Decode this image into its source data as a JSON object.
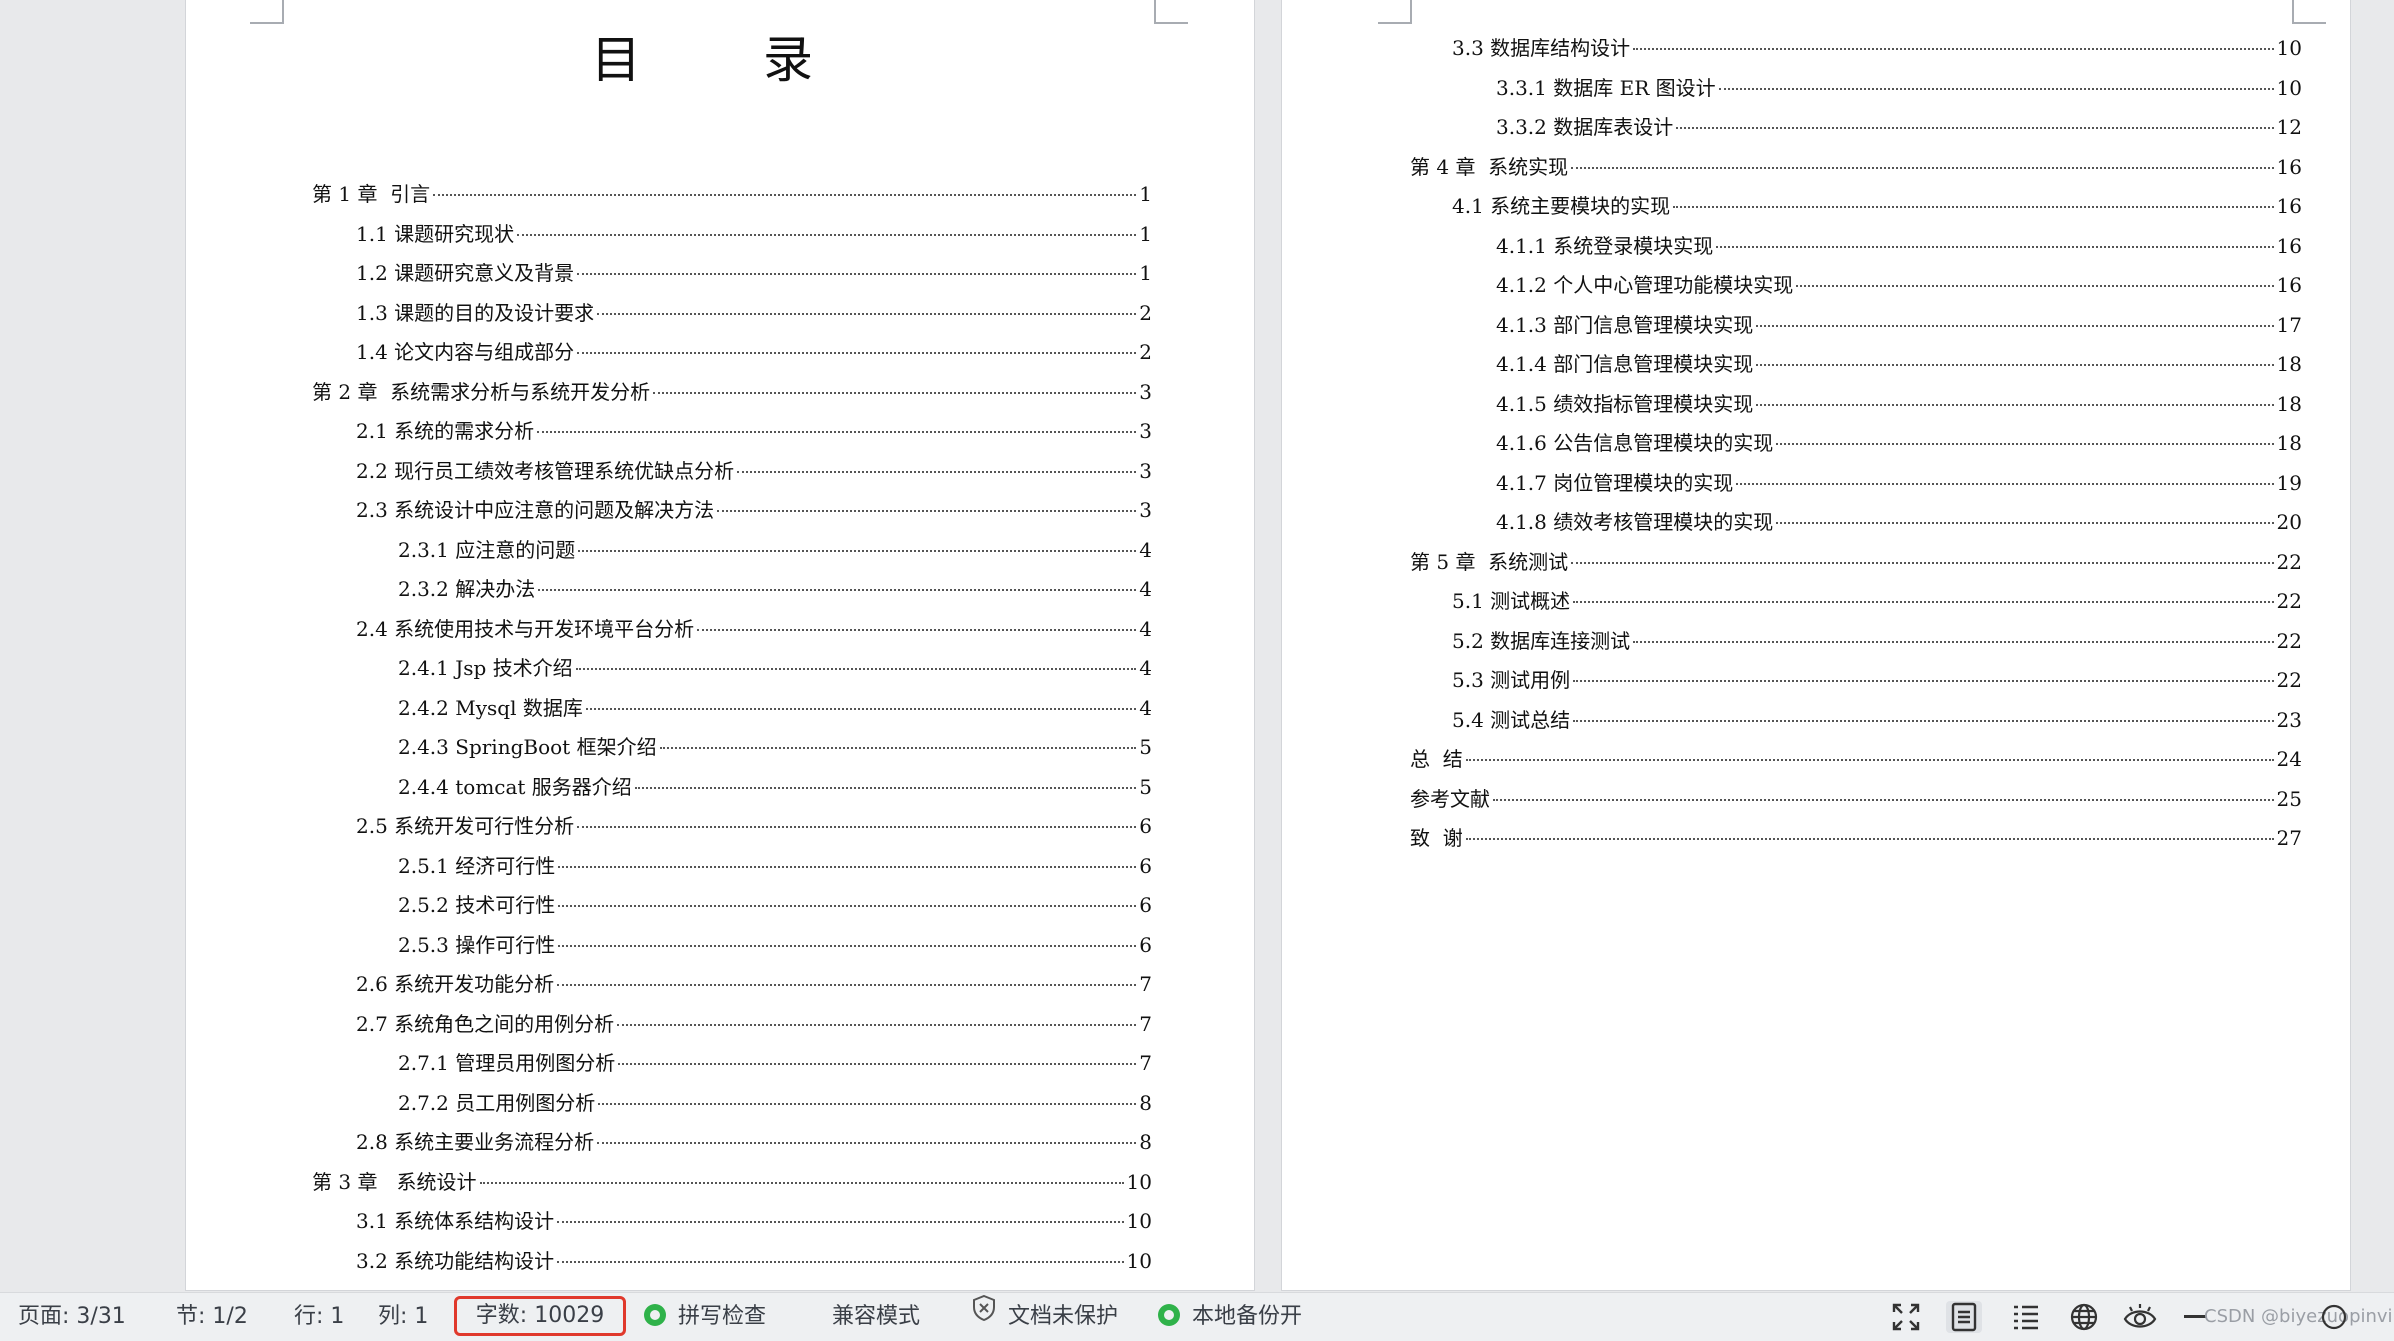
{
  "toc_title": "目　录",
  "left_entries": [
    {
      "label": "第 1 章  引言",
      "page": "1",
      "level": 0
    },
    {
      "label": "1.1 课题研究现状",
      "page": "1",
      "level": 1
    },
    {
      "label": "1.2 课题研究意义及背景",
      "page": "1",
      "level": 1
    },
    {
      "label": "1.3 课题的目的及设计要求",
      "page": "2",
      "level": 1
    },
    {
      "label": "1.4 论文内容与组成部分",
      "page": "2",
      "level": 1
    },
    {
      "label": "第 2 章  系统需求分析与系统开发分析",
      "page": "3",
      "level": 0
    },
    {
      "label": "2.1 系统的需求分析",
      "page": "3",
      "level": 1
    },
    {
      "label": "2.2 现行员工绩效考核管理系统优缺点分析",
      "page": "3",
      "level": 1
    },
    {
      "label": "2.3 系统设计中应注意的问题及解决方法",
      "page": "3",
      "level": 1
    },
    {
      "label": "2.3.1 应注意的问题",
      "page": "4",
      "level": 2
    },
    {
      "label": "2.3.2 解决办法",
      "page": "4",
      "level": 2
    },
    {
      "label": "2.4 系统使用技术与开发环境平台分析",
      "page": "4",
      "level": 1
    },
    {
      "label": "2.4.1 Jsp 技术介绍",
      "page": "4",
      "level": 2
    },
    {
      "label": "2.4.2 Mysql 数据库",
      "page": "4",
      "level": 2
    },
    {
      "label": "2.4.3 SpringBoot 框架介绍",
      "page": "5",
      "level": 2
    },
    {
      "label": "2.4.4 tomcat 服务器介绍",
      "page": "5",
      "level": 2
    },
    {
      "label": "2.5 系统开发可行性分析",
      "page": "6",
      "level": 1
    },
    {
      "label": "2.5.1 经济可行性",
      "page": "6",
      "level": 2
    },
    {
      "label": "2.5.2 技术可行性",
      "page": "6",
      "level": 2
    },
    {
      "label": "2.5.3 操作可行性",
      "page": "6",
      "level": 2
    },
    {
      "label": "2.6 系统开发功能分析",
      "page": "7",
      "level": 1
    },
    {
      "label": "2.7 系统角色之间的用例分析",
      "page": "7",
      "level": 1
    },
    {
      "label": "2.7.1 管理员用例图分析",
      "page": "7",
      "level": 2
    },
    {
      "label": "2.7.2 员工用例图分析",
      "page": "8",
      "level": 2
    },
    {
      "label": "2.8 系统主要业务流程分析",
      "page": "8",
      "level": 1
    },
    {
      "label": "第 3 章   系统设计",
      "page": "10",
      "level": 0
    },
    {
      "label": "3.1 系统体系结构设计",
      "page": "10",
      "level": 1
    },
    {
      "label": "3.2 系统功能结构设计",
      "page": "10",
      "level": 1
    }
  ],
  "right_entries": [
    {
      "label": "3.3 数据库结构设计",
      "page": "10",
      "level": 1
    },
    {
      "label": "3.3.1 数据库 ER 图设计",
      "page": "10",
      "level": 2
    },
    {
      "label": "3.3.2 数据库表设计",
      "page": "12",
      "level": 2
    },
    {
      "label": "第 4 章  系统实现",
      "page": "16",
      "level": 0
    },
    {
      "label": "4.1 系统主要模块的实现",
      "page": "16",
      "level": 1
    },
    {
      "label": "4.1.1 系统登录模块实现",
      "page": "16",
      "level": 2
    },
    {
      "label": "4.1.2 个人中心管理功能模块实现",
      "page": "16",
      "level": 2
    },
    {
      "label": "4.1.3 部门信息管理模块实现",
      "page": "17",
      "level": 2
    },
    {
      "label": "4.1.4 部门信息管理模块实现",
      "page": "18",
      "level": 2
    },
    {
      "label": "4.1.5 绩效指标管理模块实现",
      "page": "18",
      "level": 2
    },
    {
      "label": "4.1.6 公告信息管理模块的实现",
      "page": "18",
      "level": 2
    },
    {
      "label": "4.1.7 岗位管理模块的实现",
      "page": "19",
      "level": 2
    },
    {
      "label": "4.1.8 绩效考核管理模块的实现",
      "page": "20",
      "level": 2
    },
    {
      "label": "第 5 章  系统测试",
      "page": "22",
      "level": 0
    },
    {
      "label": "5.1 测试概述",
      "page": "22",
      "level": 1
    },
    {
      "label": "5.2 数据库连接测试",
      "page": "22",
      "level": 1
    },
    {
      "label": "5.3 测试用例",
      "page": "22",
      "level": 1
    },
    {
      "label": "5.4 测试总结",
      "page": "23",
      "level": 1
    },
    {
      "label": "总  结",
      "page": "24",
      "level": 0
    },
    {
      "label": "参考文献",
      "page": "25",
      "level": 0
    },
    {
      "label": "致  谢",
      "page": "27",
      "level": 0
    }
  ],
  "statusbar": {
    "page": "页面: 3/31",
    "section": "节: 1/2",
    "row": "行: 1",
    "col": "列: 1",
    "word_count": "字数: 10029",
    "spell_check": "拼写检查",
    "compat_mode": "兼容模式",
    "doc_protect": "文档未保护",
    "backup": "本地备份开",
    "watermark": "CSDN @biyezuopinvip",
    "accent_color": "#e0392c",
    "ok_color": "#2fb24a"
  }
}
